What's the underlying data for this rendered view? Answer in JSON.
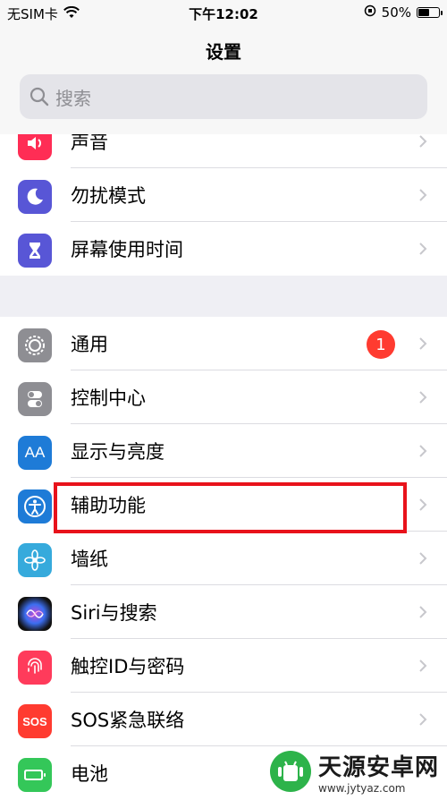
{
  "status_bar": {
    "carrier": "无SIM卡",
    "time": "下午12:02",
    "battery": "50%",
    "battery_level": 0.5
  },
  "header": {
    "title": "设置",
    "search_placeholder": "搜索"
  },
  "group1": [
    {
      "label": "声音",
      "icon": "speaker-icon",
      "color": "#ff2d55"
    },
    {
      "label": "勿扰模式",
      "icon": "moon-icon",
      "color": "#5856d6"
    },
    {
      "label": "屏幕使用时间",
      "icon": "hourglass-icon",
      "color": "#5856d6"
    }
  ],
  "group2": [
    {
      "label": "通用",
      "icon": "gear-icon",
      "color": "#8e8e93",
      "badge": "1"
    },
    {
      "label": "控制中心",
      "icon": "toggles-icon",
      "color": "#8e8e93"
    },
    {
      "label": "显示与亮度",
      "icon": "text-size-icon",
      "color": "#1e7bd7"
    },
    {
      "label": "辅助功能",
      "icon": "accessibility-icon",
      "color": "#1e7bd7"
    },
    {
      "label": "墙纸",
      "icon": "flower-icon",
      "color": "#36aadc"
    },
    {
      "label": "Siri与搜索",
      "icon": "siri-icon",
      "color": "#222"
    },
    {
      "label": "触控ID与密码",
      "icon": "fingerprint-icon",
      "color": "#ff3b5b"
    },
    {
      "label": "SOS紧急联络",
      "icon": "sos-icon",
      "color": "#ff3b30",
      "icon_text": "SOS"
    },
    {
      "label": "电池",
      "icon": "battery-icon",
      "color": "#34c759"
    }
  ],
  "watermark": {
    "name": "天源安卓网",
    "url": "www.jytyaz.com"
  },
  "colors": {
    "highlight": "#e8121b",
    "chevron": "#c7c7cc"
  }
}
